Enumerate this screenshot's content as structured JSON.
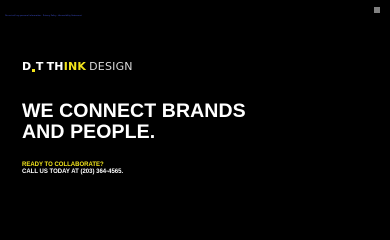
{
  "top_bar": {
    "link_text": "Do not sell my personal information · Privacy Policy · Accessibility Statement"
  },
  "menu": {
    "icon": "hamburger-menu-icon"
  },
  "logo": {
    "part_d": "D",
    "part_t": "T",
    "part_th": "TH",
    "part_ink": "INK",
    "part_design": "DESIGN"
  },
  "hero": {
    "headline_line1": "WE CONNECT BRANDS",
    "headline_line2": "AND PEOPLE."
  },
  "cta": {
    "label": "READY TO COLLABORATE?",
    "phone_line": "CALL US TODAY AT (203) 364-4565."
  },
  "colors": {
    "background": "#000000",
    "accent": "#f2e41c",
    "text": "#ffffff",
    "link": "#3d4fd0"
  }
}
